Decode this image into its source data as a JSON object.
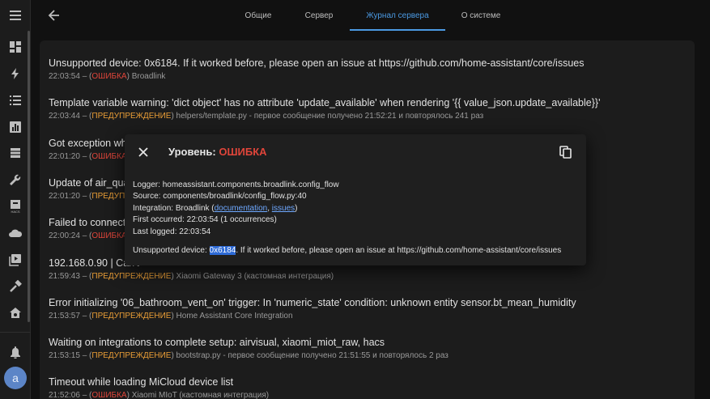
{
  "header": {
    "tabs": [
      {
        "label": "Общие",
        "active": false
      },
      {
        "label": "Сервер",
        "active": false
      },
      {
        "label": "Журнал сервера",
        "active": true
      },
      {
        "label": "О системе",
        "active": false
      }
    ]
  },
  "sidebar": {
    "items": [
      "overview-icon",
      "energy-icon",
      "logbook-icon",
      "history-icon",
      "hacs-store-icon",
      "developer-tools-icon",
      "hacs-icon",
      "cloud-icon",
      "media-icon",
      "tools-icon",
      "settings-icon"
    ],
    "notifications_icon": "bell-icon",
    "avatar_letter": "a"
  },
  "log_entries": [
    {
      "message": "Unsupported device: 0x6184. If it worked before, please open an issue at https://github.com/home-assistant/core/issues",
      "time": "22:03:54",
      "level": "ОШИБКА",
      "level_type": "error",
      "source": "Broadlink"
    },
    {
      "message": "Template variable warning: 'dict object' has no attribute 'update_available' when rendering '{{ value_json.update_available}}'",
      "time": "22:03:44",
      "level": "ПРЕДУПРЕЖДЕНИЕ",
      "level_type": "warning",
      "source": "helpers/template.py - первое сообщение получено 21:52:21 и повторялось 241 раз"
    },
    {
      "message": "Got exception while",
      "time": "22:01:20",
      "level": "ОШИБКА",
      "level_type": "error",
      "source": ""
    },
    {
      "message": "Update of air_qualit",
      "time": "22:01:20",
      "level": "ПРЕДУПРЕ",
      "level_type": "warning",
      "source": ""
    },
    {
      "message": "Failed to connect to",
      "time": "22:00:24",
      "level": "ОШИБКА",
      "level_type": "error",
      "source": ""
    },
    {
      "message": "192.168.0.90 | Can't",
      "time": "21:59:43",
      "level": "ПРЕДУПРЕЖДЕНИЕ",
      "level_type": "warning",
      "source": "Xiaomi Gateway 3 (кастомная интеграция)"
    },
    {
      "message": "Error initializing '06_bathroom_vent_on' trigger: In 'numeric_state' condition: unknown entity sensor.bt_mean_humidity",
      "time": "21:53:57",
      "level": "ПРЕДУПРЕЖДЕНИЕ",
      "level_type": "warning",
      "source": "Home Assistant Core Integration"
    },
    {
      "message": "Waiting on integrations to complete setup: airvisual, xiaomi_miot_raw, hacs",
      "time": "21:53:15",
      "level": "ПРЕДУПРЕЖДЕНИЕ",
      "level_type": "warning",
      "source": "bootstrap.py - первое сообщение получено 21:51:55 и повторялось 2 раз"
    },
    {
      "message": "Timeout while loading MiCloud device list",
      "time": "21:52:06",
      "level": "ОШИБКА",
      "level_type": "error",
      "source": "Xiaomi MIoT (кастомная интеграция)"
    }
  ],
  "dialog": {
    "title_prefix": "Уровень:",
    "title_level": "ОШИБКА",
    "logger": "Logger: homeassistant.components.broadlink.config_flow",
    "source": "Source: components/broadlink/config_flow.py:40",
    "integration_prefix": "Integration: Broadlink (",
    "integration_doc_link": "documentation",
    "integration_sep": ", ",
    "integration_issues_link": "issues",
    "integration_suffix": ")",
    "first_occurred": "First occurred: 22:03:54 (1 occurrences)",
    "last_logged": "Last logged: 22:03:54",
    "message_prefix": "Unsupported device: ",
    "message_highlight": "0x6184",
    "message_suffix": ". If it worked before, please open an issue at https://github.com/home-assistant/core/issues"
  },
  "colors": {
    "error": "#e0453a",
    "warning": "#e99d36",
    "accent": "#4b9ae3",
    "link": "#6ea8ff",
    "selection": "#2d6ad6"
  }
}
